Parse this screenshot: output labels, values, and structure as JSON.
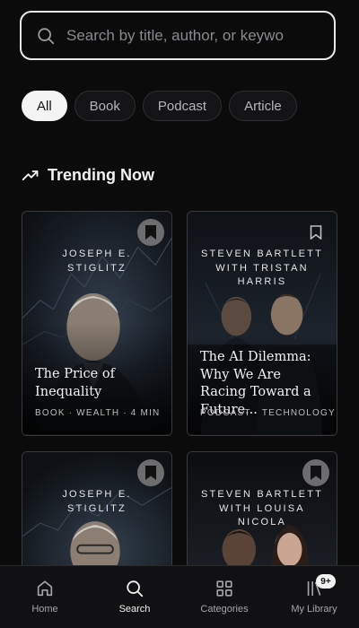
{
  "search": {
    "placeholder": "Search by title, author, or keywo"
  },
  "filters": [
    {
      "label": "All",
      "active": true
    },
    {
      "label": "Book",
      "active": false
    },
    {
      "label": "Podcast",
      "active": false
    },
    {
      "label": "Article",
      "active": false
    }
  ],
  "trending": {
    "title": "Trending Now",
    "icon": "trending-up-icon",
    "cards": [
      {
        "author": "JOSEPH E. STIGLITZ",
        "title": "The Price of Inequality",
        "meta": "BOOK · WEALTH · 4 MIN",
        "bookmark": "filled"
      },
      {
        "author": "STEVEN BARTLETT WITH TRISTAN HARRIS",
        "title": "The AI Dilemma: Why We Are Racing Toward a Future...",
        "meta": "PODCAST · TECHNOLOGY",
        "bookmark": "outline"
      },
      {
        "author": "JOSEPH E. STIGLITZ",
        "title": "",
        "meta": "",
        "bookmark": "filled"
      },
      {
        "author": "STEVEN BARTLETT WITH LOUISA NICOLA",
        "title": "",
        "meta": "",
        "bookmark": "filled"
      }
    ]
  },
  "nav": {
    "items": [
      {
        "label": "Home",
        "icon": "home-icon",
        "active": false
      },
      {
        "label": "Search",
        "icon": "search-icon",
        "active": true
      },
      {
        "label": "Categories",
        "icon": "grid-icon",
        "active": false
      },
      {
        "label": "My Library",
        "icon": "library-icon",
        "active": false
      }
    ],
    "library_badge": "9+"
  },
  "colors": {
    "background": "#0b0b0c",
    "accent": "#f4f4f4",
    "muted": "#8a8a8e"
  }
}
